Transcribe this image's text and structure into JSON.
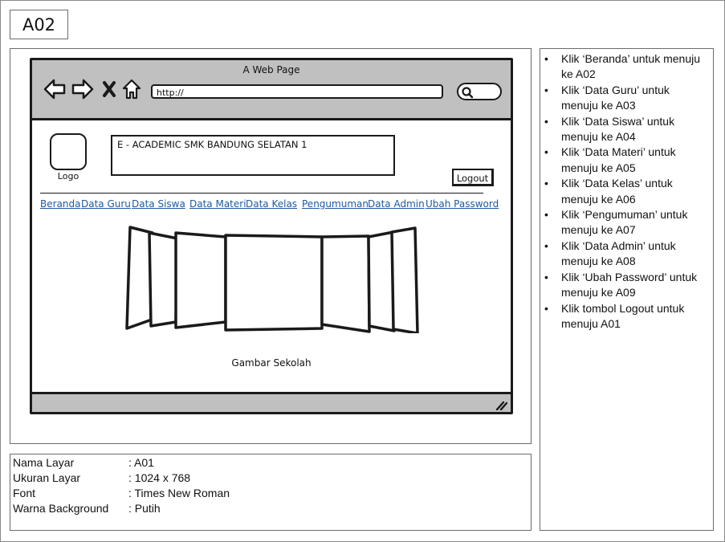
{
  "screen_id": "A02",
  "browser": {
    "title": "A Web Page",
    "url": "http://"
  },
  "header": {
    "logo_label": "Logo",
    "school_title": "E - ACADEMIC SMK BANDUNG SELATAN 1",
    "logout_label": "Logout"
  },
  "nav": {
    "items": [
      "Beranda",
      "Data Guru",
      "Data Siswa",
      "Data Materi",
      "Data Kelas",
      "Pengumuman",
      "Data Admin",
      "Ubah Password"
    ]
  },
  "carousel": {
    "caption": "Gambar Sekolah"
  },
  "notes": [
    "Klik ‘Beranda’ untuk menuju ke A02",
    "Klik ‘Data Guru’ untuk menuju ke A03",
    "Klik ‘Data Siswa’ untuk menuju ke A04",
    "Klik ‘Data Materi’ untuk menuju ke A05",
    "Klik ‘Data Kelas’ untuk menuju ke A06",
    "Klik ‘Pengumuman’ untuk menuju ke A07",
    "Klik ‘Data Admin’ untuk menuju ke A08",
    "Klik ‘Ubah Password’ untuk menuju ke A09",
    "Klik tombol Logout untuk menuju A01"
  ],
  "info": {
    "rows": [
      {
        "key": "Nama Layar",
        "value": ": A01"
      },
      {
        "key": "Ukuran Layar",
        "value": ": 1024 x 768"
      },
      {
        "key": "Font",
        "value": ": Times New Roman"
      },
      {
        "key": "Warna Background",
        "value": ": Putih"
      }
    ]
  },
  "icons": [
    "back-arrow-icon",
    "forward-arrow-icon",
    "close-icon",
    "home-icon",
    "search-icon",
    "resize-grip-icon",
    "image-carousel-icon"
  ]
}
